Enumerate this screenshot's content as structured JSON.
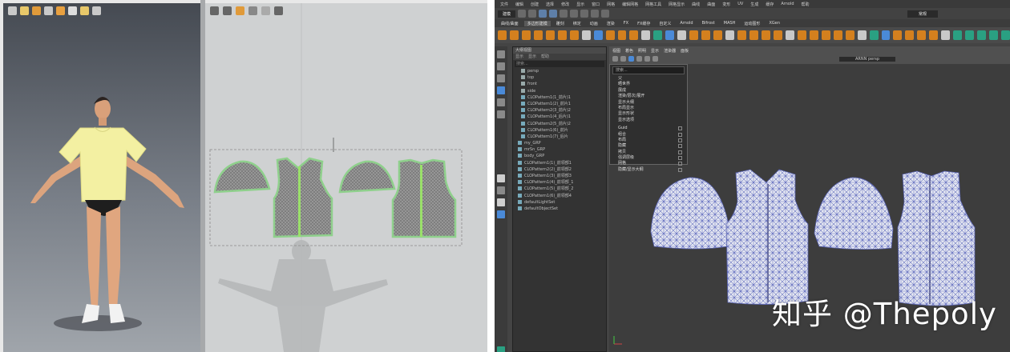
{
  "watermark": "知乎 @Thepoly",
  "maya": {
    "menubar": [
      "文件",
      "编辑",
      "创建",
      "选择",
      "修改",
      "显示",
      "窗口",
      "网格",
      "编辑网格",
      "网格工具",
      "网格显示",
      "曲线",
      "曲面",
      "变形",
      "UV",
      "生成",
      "缓存",
      "Arnold",
      "帮助"
    ],
    "mode_select": "建模",
    "workspace_select": "常规",
    "shelf_tabs": [
      "曲线/曲面",
      "多边形建模",
      "雕刻",
      "绑定",
      "动画",
      "渲染",
      "FX",
      "FX缓存",
      "自定义",
      "Arnold",
      "Bifrost",
      "MASH",
      "运动图形",
      "XGen"
    ],
    "viewport_menu": [
      "视图",
      "着色",
      "照明",
      "显示",
      "渲染器",
      "面板"
    ],
    "viewport_camera": "ARNN persp",
    "outliner": {
      "title": "大纲视图",
      "menu": [
        "显示",
        "显示",
        "帮助"
      ],
      "search_placeholder": "搜索...",
      "items": [
        "persp",
        "top",
        "front",
        "side",
        "CLOPattern1(1_前片)1",
        "CLOPattern1(2)_前片1",
        "CLOPattern2(3_前片)2",
        "CLOPattern1(4_后片)1",
        "CLOPattern2(5_前片)2",
        "CLOPattern1(6)_前片",
        "CLOPattern1(7)_后片",
        "my_GRP",
        "mrSn_GRP",
        "body_GRP",
        "CLOPattern1(1)_前领部1",
        "CLOPattern2(2)_前领部2",
        "CLOPattern1(3)_前领部3",
        "CLOPattern1(4)_前领部_1",
        "CLOPattern1(5)_前领部_2",
        "CLOPattern1(6)_前领部4",
        "defaultLightSet",
        "defaultObjectSet"
      ]
    },
    "context_menu": {
      "search": "搜索...",
      "items": [
        "父",
        "晒世界",
        "展成",
        "渲染/层次/展开",
        "显示大纲",
        "布局显示",
        "显示形状",
        "显示选项"
      ],
      "checks": [
        "Guid",
        "组合",
        "布局",
        "隐藏",
        "拷贝",
        "强调层级",
        "网格",
        "隐藏/显示大纲"
      ]
    }
  },
  "colors": {
    "maya_bg": "#444444",
    "viewport": "#3d3d3d",
    "shelf_orange": "#d4801e",
    "shelf_teal": "#2aa082",
    "shelf_blue": "#4a8ad8",
    "clo_3d_top": "#454a52",
    "clo_2d_bg": "#cfd1d2",
    "pattern_outline": "#8fd08c",
    "mesh_blue": "#6570c0",
    "tshirt": "#f3f0a2",
    "pattern_fill": "#8c8c8c",
    "zipper": "#9ae06a"
  },
  "icons": [
    "pointer-icon",
    "move-icon",
    "rotate-icon",
    "scale-icon",
    "snap-icon",
    "render-icon"
  ]
}
